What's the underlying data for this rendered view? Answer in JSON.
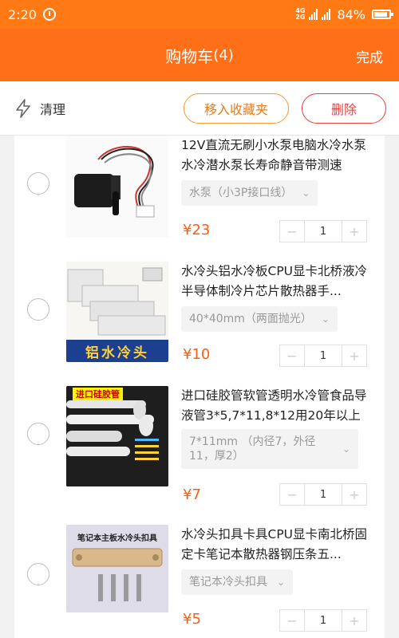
{
  "status_bar": {
    "time": "2:20",
    "network": "4G 2G",
    "battery": "84%"
  },
  "header": {
    "title": "购物车",
    "count": "(4)",
    "done": "完成"
  },
  "toolbar": {
    "clean_label": "清理",
    "fav_label": "移入收藏夹",
    "delete_label": "删除"
  },
  "items": [
    {
      "title": "12V直流无刷小水泵电脑水冷水泵水冷潜水泵长寿命静音带测速",
      "sku": "水泵（小3P接口线）",
      "price": "¥23",
      "qty": "1"
    },
    {
      "title": "水冷头铝水冷板CPU显卡北桥液冷半导体制冷片芯片散热器手...",
      "sku": "40*40mm（两面抛光）",
      "price": "¥10",
      "qty": "1",
      "image_text": "铝水冷头"
    },
    {
      "title": "进口硅胶管软管透明水冷管食品导液管3*5,7*11,8*12用20年以上",
      "sku": "7*11mm （内径7，外径11，厚2）",
      "price": "¥7",
      "qty": "1",
      "image_text": "进口硅胶管"
    },
    {
      "title": "水冷头扣具卡具CPU显卡南北桥固定卡笔记本散热器钢压条五...",
      "sku": "笔记本冷头扣具",
      "price": "¥5",
      "qty": "1",
      "image_text": "笔记本主板水冷头扣具"
    }
  ],
  "colors": {
    "header": "#ff6f18",
    "accent": "#f4601a",
    "delete": "#e8403f"
  }
}
